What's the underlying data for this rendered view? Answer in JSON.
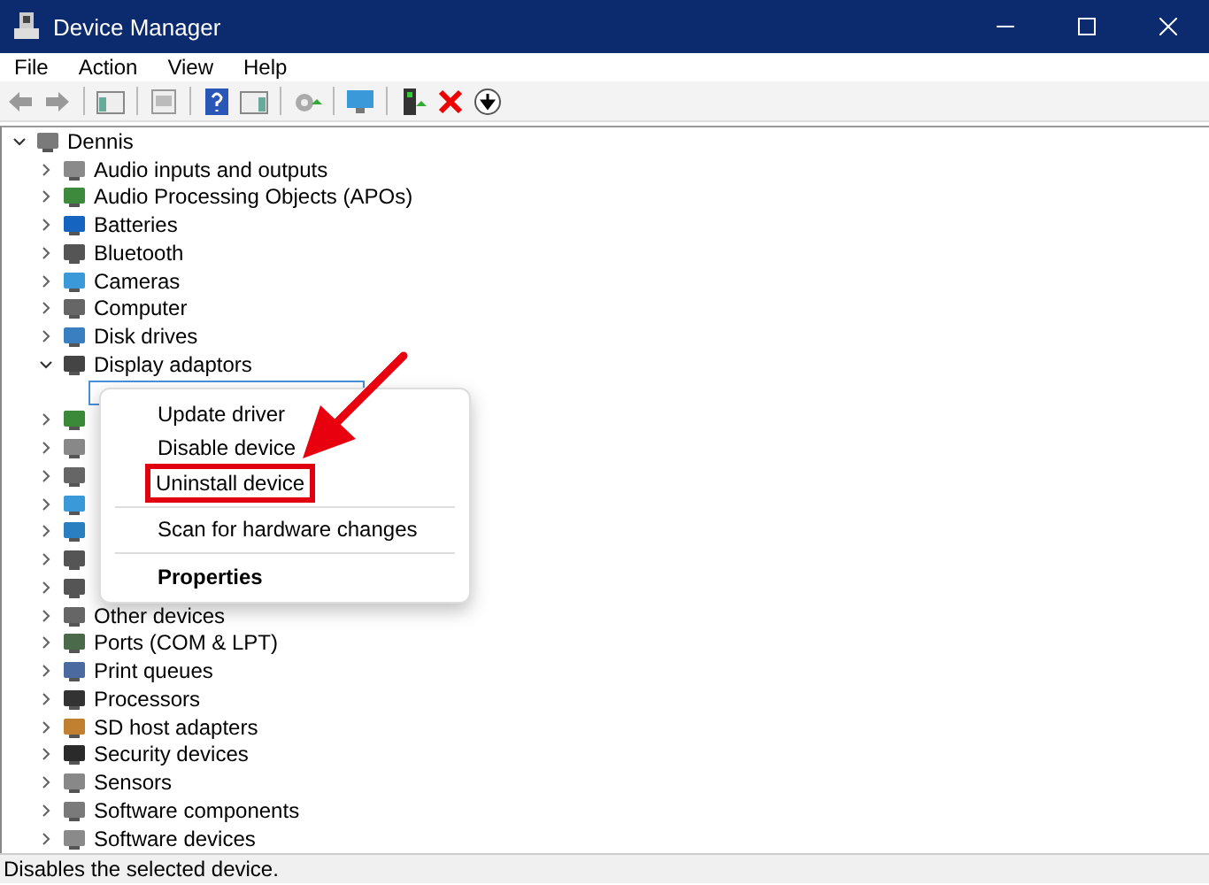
{
  "window": {
    "title": "Device Manager"
  },
  "menu_bar": [
    "File",
    "Action",
    "View",
    "Help"
  ],
  "tree": [
    {
      "label": "Dennis",
      "expanded": true,
      "children": [
        {
          "label": "Audio inputs and outputs",
          "expanded": false
        },
        {
          "label": "Audio Processing Objects (APOs)",
          "expanded": false
        },
        {
          "label": "Batteries",
          "expanded": false
        },
        {
          "label": "Bluetooth",
          "expanded": false
        },
        {
          "label": "Cameras",
          "expanded": false
        },
        {
          "label": "Computer",
          "expanded": false
        },
        {
          "label": "Disk drives",
          "expanded": false
        },
        {
          "label": "Display adaptors",
          "expanded": true,
          "children": [
            {
              "selected": true
            }
          ]
        },
        {
          "expanded": false
        },
        {
          "expanded": false
        },
        {
          "expanded": false
        },
        {
          "expanded": false
        },
        {
          "expanded": false
        },
        {
          "expanded": false
        },
        {
          "expanded": false
        },
        {
          "label": "Other devices",
          "expanded": false
        },
        {
          "label": "Ports (COM & LPT)",
          "expanded": false
        },
        {
          "label": "Print queues",
          "expanded": false
        },
        {
          "label": "Processors",
          "expanded": false
        },
        {
          "label": "SD host adapters",
          "expanded": false
        },
        {
          "label": "Security devices",
          "expanded": false
        },
        {
          "label": "Sensors",
          "expanded": false
        },
        {
          "label": "Software components",
          "expanded": false
        },
        {
          "label": "Software devices",
          "expanded": false
        }
      ]
    }
  ],
  "context_menu": [
    {
      "kind": "item",
      "label": "Update driver",
      "highlighted": false,
      "default": false
    },
    {
      "kind": "item",
      "label": "Disable device",
      "highlighted": false,
      "default": false
    },
    {
      "kind": "item",
      "label": "Uninstall device",
      "highlighted": true,
      "default": false
    },
    {
      "kind": "separator"
    },
    {
      "kind": "item",
      "label": "Scan for hardware changes",
      "highlighted": false,
      "default": false
    },
    {
      "kind": "separator"
    },
    {
      "kind": "item",
      "label": "Properties",
      "highlighted": false,
      "default": true
    }
  ],
  "status_bar": "Disables the selected device."
}
